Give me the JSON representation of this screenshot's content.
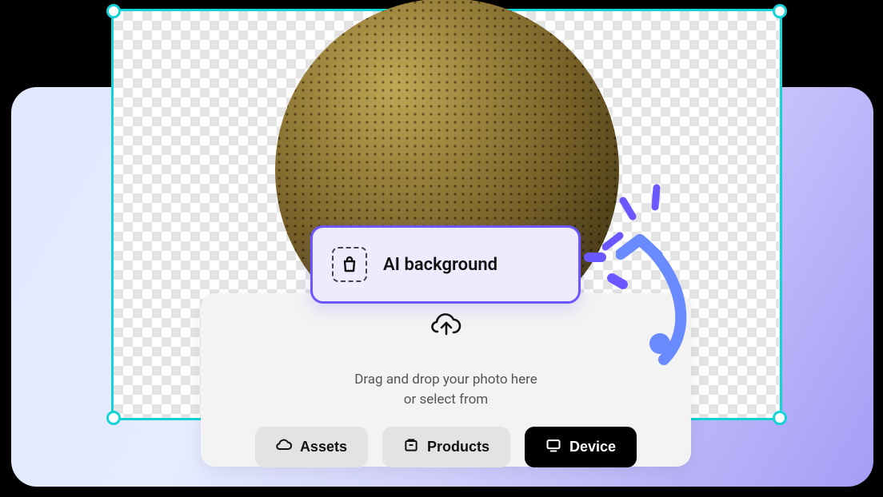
{
  "popover": {
    "label": "AI background",
    "icon": "bag-dashed-icon"
  },
  "uploadPanel": {
    "instructionLine1": "Drag and drop your photo here",
    "instructionLine2": "or select from",
    "uploadIcon": "cloud-upload-icon",
    "buttons": {
      "assets": {
        "label": "Assets",
        "icon": "cloud-icon"
      },
      "products": {
        "label": "Products",
        "icon": "package-icon"
      },
      "device": {
        "label": "Device",
        "icon": "monitor-icon"
      }
    }
  },
  "canvas": {
    "subject": "spherical-speaker-grille",
    "borderColor": "#14d3d6",
    "handleCount": 4
  },
  "colors": {
    "accent": "#6a57ff",
    "canvasBorder": "#14d3d6",
    "gradientStart": "#dfe8fd",
    "gradientEnd": "#a59cf6"
  }
}
